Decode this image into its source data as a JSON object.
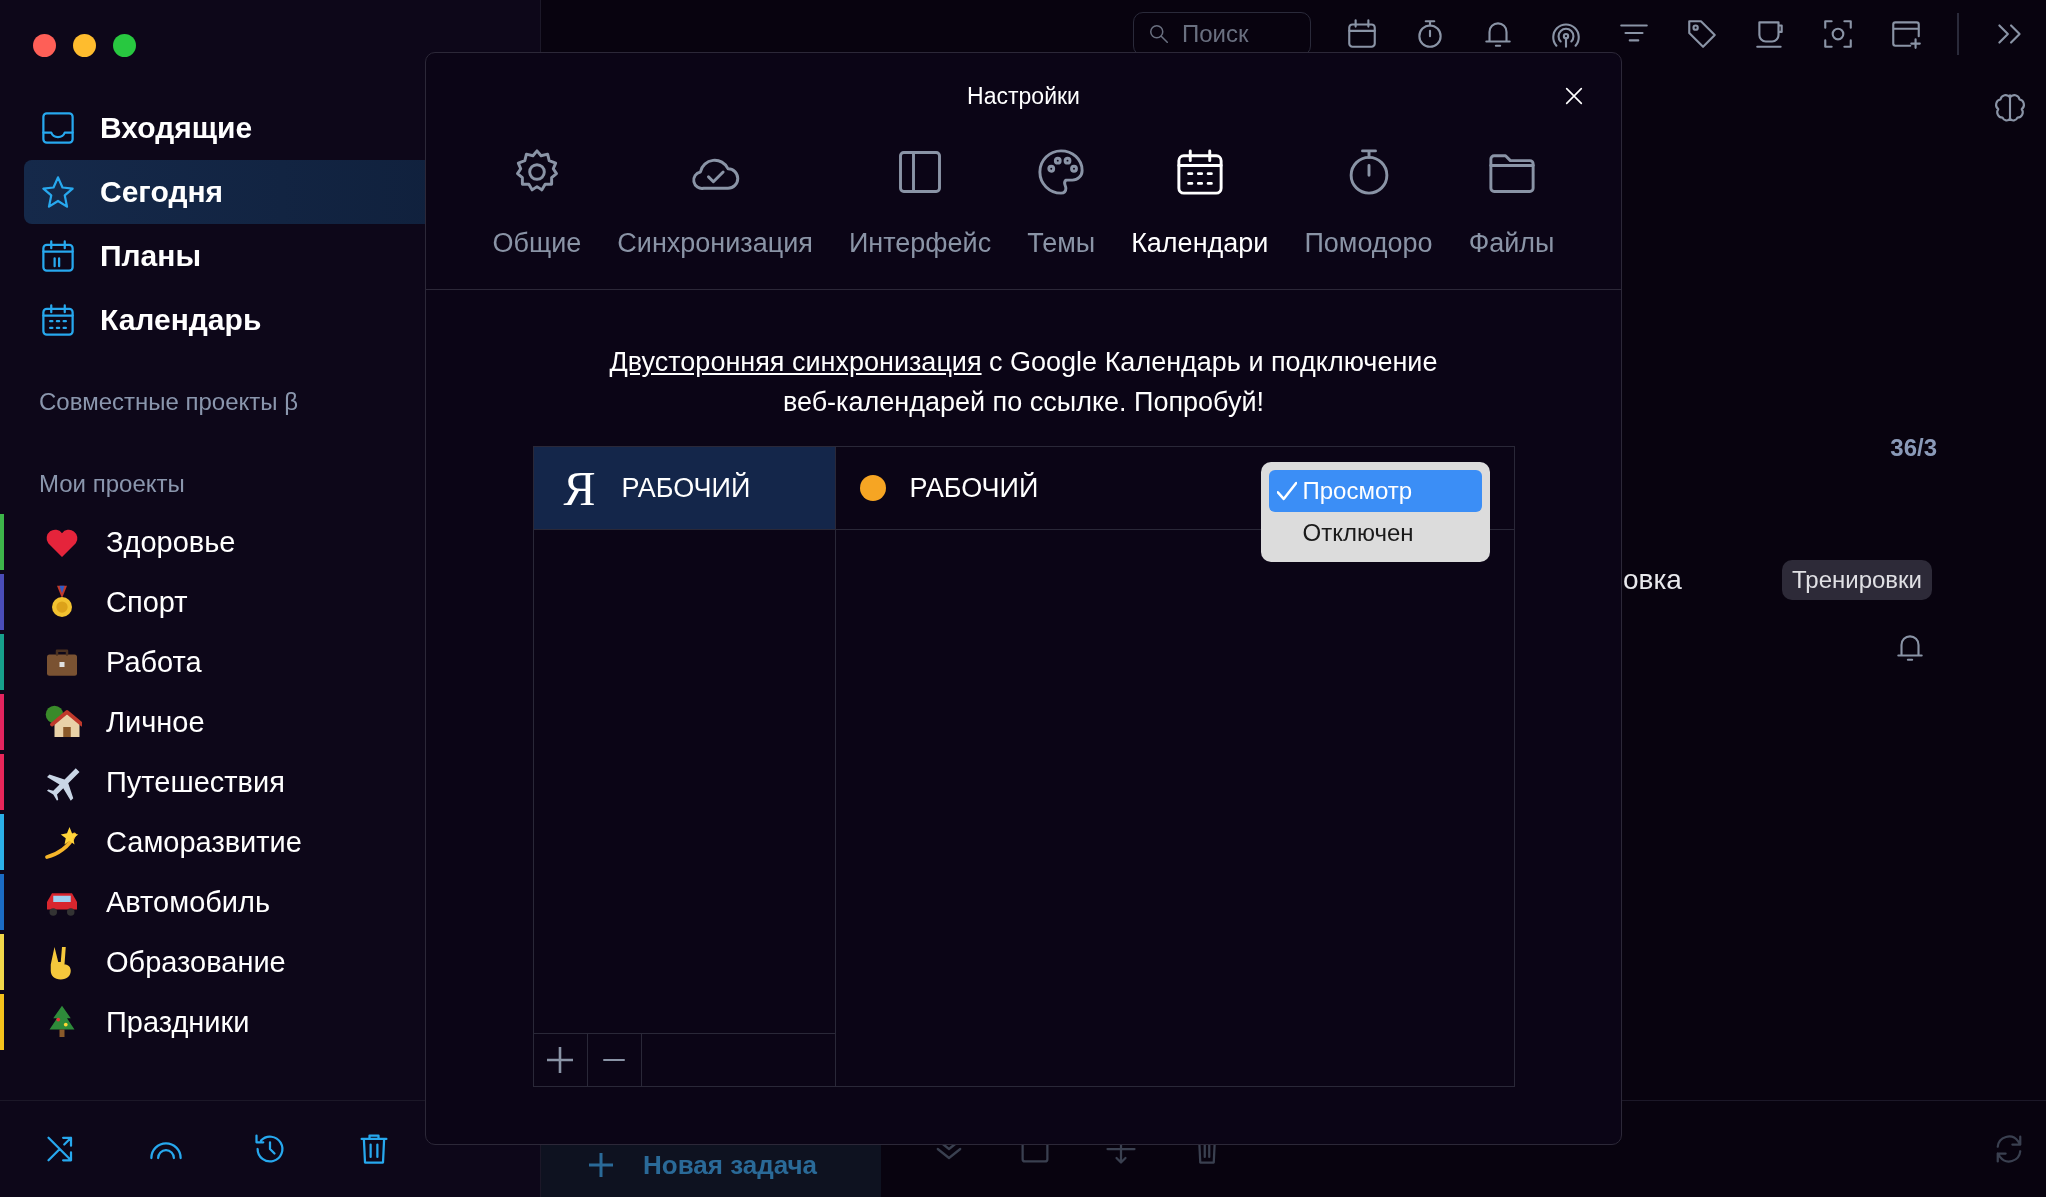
{
  "window": {
    "controls": [
      {
        "color": "#fe5f57"
      },
      {
        "color": "#febc2e"
      },
      {
        "color": "#28c840"
      }
    ]
  },
  "sidebar": {
    "nav": [
      {
        "label": "Входящие",
        "selected": false
      },
      {
        "label": "Сегодня",
        "selected": true
      },
      {
        "label": "Планы",
        "selected": false
      },
      {
        "label": "Календарь",
        "selected": false
      }
    ],
    "shared_heading": "Совместные проекты β",
    "projects_heading": "Мои проекты",
    "projects": [
      {
        "label": "Здоровье",
        "color": "#3db54a"
      },
      {
        "label": "Спорт",
        "color": "#4a4cb8"
      },
      {
        "label": "Работа",
        "color": "#17a08c"
      },
      {
        "label": "Личное",
        "color": "#e3245f"
      },
      {
        "label": "Путешествия",
        "color": "#e8265a"
      },
      {
        "label": "Саморазвитие",
        "color": "#2bb0e8"
      },
      {
        "label": "Автомобиль",
        "color": "#1b6cc4"
      },
      {
        "label": "Образование",
        "color": "#f2d84a"
      },
      {
        "label": "Праздники",
        "color": "#f4c21c"
      }
    ]
  },
  "toolbar": {
    "search": {
      "placeholder": "Поиск"
    }
  },
  "background": {
    "counter": "36/3",
    "task_fragment": "овка",
    "tag": "Тренировки",
    "new_task": "Новая задача"
  },
  "settings": {
    "title": "Настройки",
    "tabs": [
      {
        "label": "Общие",
        "selected": false
      },
      {
        "label": "Синхронизация",
        "selected": false
      },
      {
        "label": "Интерфейс",
        "selected": false
      },
      {
        "label": "Темы",
        "selected": false
      },
      {
        "label": "Календари",
        "selected": true
      },
      {
        "label": "Помодоро",
        "selected": false
      },
      {
        "label": "Файлы",
        "selected": false
      }
    ],
    "promo": {
      "link": "Двусторонняя синхронизация",
      "text": " с Google Календарь и подключение веб-календарей по ссылке. Попробуй!"
    },
    "accounts": [
      {
        "logo": "Я",
        "name": "РАБОЧИЙ",
        "selected": true
      }
    ],
    "calendars": [
      {
        "name": "РАБОЧИЙ",
        "color": "#f6a523"
      }
    ],
    "menu": [
      {
        "label": "Просмотр",
        "selected": true
      },
      {
        "label": "Отключен",
        "selected": false
      }
    ]
  }
}
